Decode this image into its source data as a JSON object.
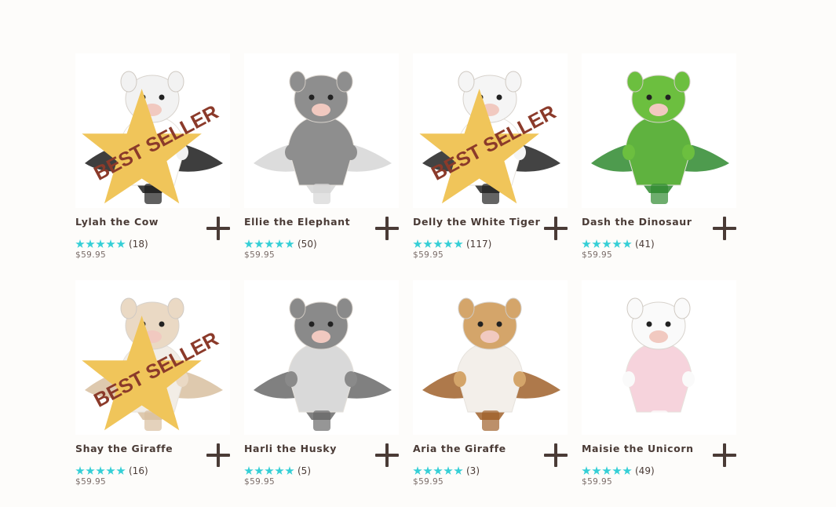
{
  "products": [
    {
      "name": "Lylah the Cow",
      "count": "(18)",
      "price": "$59.95",
      "badge": "BEST SELLER",
      "body": "#ffffff",
      "accent": "#1c1c1c",
      "face": "#f2f2f2",
      "icon": "cow-plush-image"
    },
    {
      "name": "Ellie the Elephant",
      "count": "(50)",
      "price": "$59.95",
      "badge": "",
      "body": "#8e8e8e",
      "accent": "#d6d6d6",
      "face": "#8e8e8e",
      "icon": "elephant-plush-image"
    },
    {
      "name": "Delly the White Tiger",
      "count": "(117)",
      "price": "$59.95",
      "badge": "BEST SELLER",
      "body": "#ffffff",
      "accent": "#222222",
      "face": "#f5f5f5",
      "icon": "white-tiger-plush-image"
    },
    {
      "name": "Dash the Dinosaur",
      "count": "(41)",
      "price": "$59.95",
      "badge": "",
      "body": "#5fb23f",
      "accent": "#2f8a2f",
      "face": "#6cbf3f",
      "icon": "dinosaur-plush-image"
    },
    {
      "name": "Shay the Giraffe",
      "count": "(16)",
      "price": "$59.95",
      "badge": "BEST SELLER",
      "body": "#f2ede6",
      "accent": "#d8bfa0",
      "face": "#ead9c4",
      "icon": "giraffe-plush-image"
    },
    {
      "name": "Harli the Husky",
      "count": "(5)",
      "price": "$59.95",
      "badge": "",
      "body": "#d9d9d9",
      "accent": "#6a6a6a",
      "face": "#8a8a8a",
      "icon": "husky-plush-image"
    },
    {
      "name": "Aria the Giraffe",
      "count": "(3)",
      "price": "$59.95",
      "badge": "",
      "body": "#f3efea",
      "accent": "#a0612b",
      "face": "#d4a56a",
      "icon": "giraffe-plush-image"
    },
    {
      "name": "Maisie the Unicorn",
      "count": "(49)",
      "price": "$59.95",
      "badge": "",
      "body": "#f6d3dc",
      "accent": "#ffffff",
      "face": "#fafafa",
      "icon": "unicorn-plush-image"
    }
  ],
  "rating": {
    "stars": 5,
    "star_color": "#35cfd6"
  },
  "badge_color": "#f0c55a",
  "badge_text_color": "#8b3a2a"
}
